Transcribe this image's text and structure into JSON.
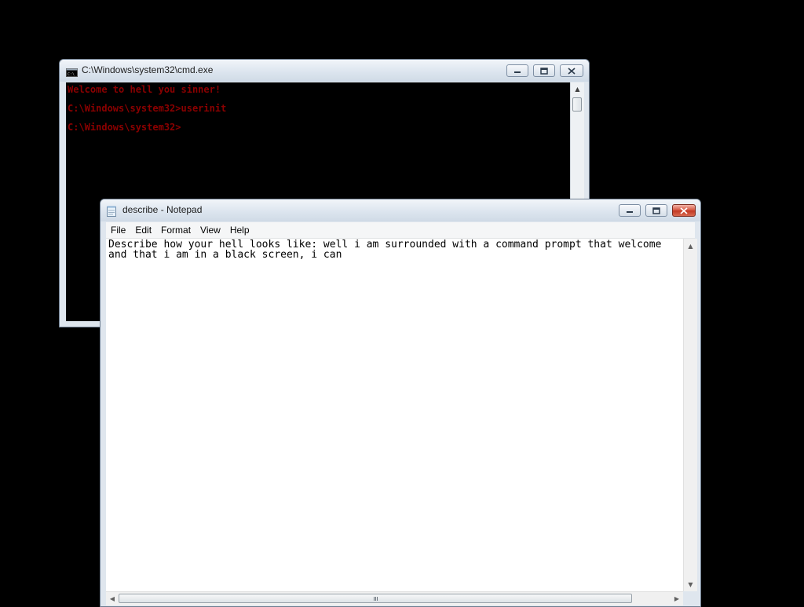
{
  "cmd_window": {
    "title": "C:\\Windows\\system32\\cmd.exe",
    "icon": "console-icon",
    "console_color": "#8b0000",
    "lines": [
      "Welcome to hell you sinner!",
      "C:\\Windows\\system32>userinit",
      "C:\\Windows\\system32>"
    ]
  },
  "notepad_window": {
    "title": "describe - Notepad",
    "icon": "notepad-icon",
    "menu": [
      "File",
      "Edit",
      "Format",
      "View",
      "Help"
    ],
    "text": "Describe how your hell looks like: well i am surrounded with a command prompt that welcome\nand that i am in a black screen, i can"
  },
  "colors": {
    "desktop": "#000000",
    "close_button": "#c23a25"
  }
}
